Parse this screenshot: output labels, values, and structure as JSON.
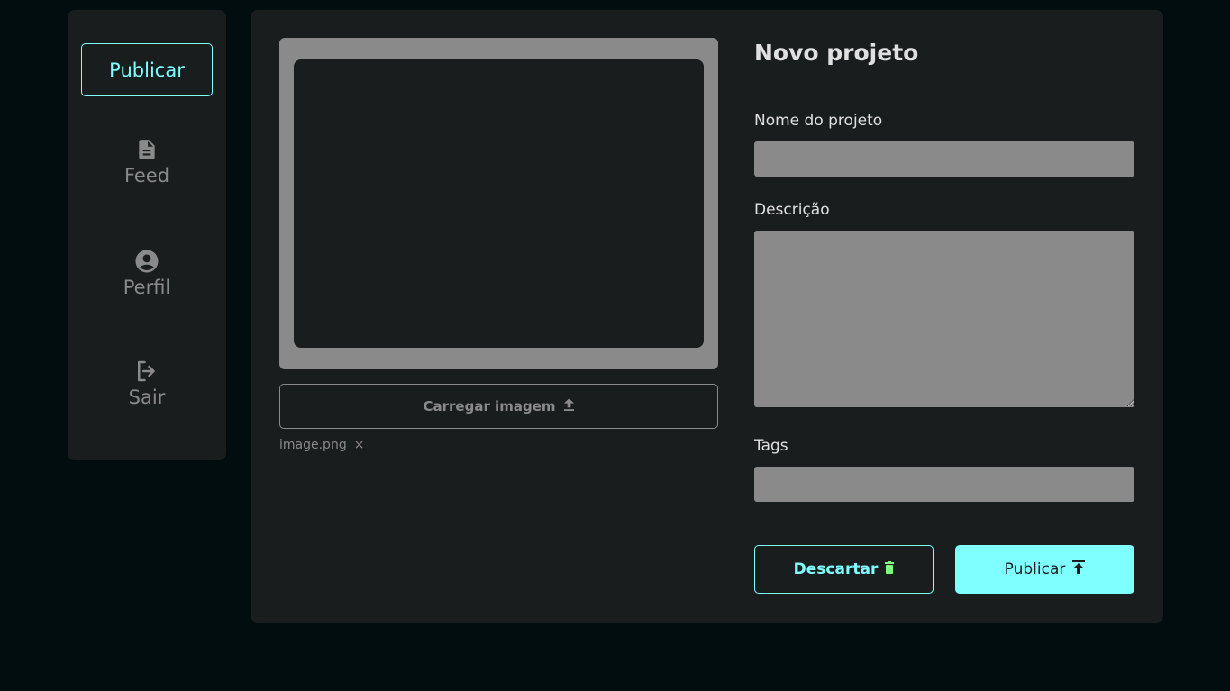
{
  "sidebar": {
    "primary_label": "Publicar",
    "items": [
      {
        "label": "Feed",
        "icon": "document-icon"
      },
      {
        "label": "Perfil",
        "icon": "account-circle-icon"
      },
      {
        "label": "Sair",
        "icon": "logout-icon"
      }
    ]
  },
  "upload": {
    "button_label": "Carregar imagem",
    "file_name": "image.png",
    "remove_glyph": "×"
  },
  "form": {
    "title": "Novo projeto",
    "name_label": "Nome do projeto",
    "name_value": "",
    "description_label": "Descrição",
    "description_value": "",
    "tags_label": "Tags",
    "tags_value": "",
    "discard_label": "Descartar",
    "publish_label": "Publicar"
  },
  "colors": {
    "accent": "#7fffff",
    "panel": "#1a1d1e",
    "background": "#010d0e",
    "muted": "#8a8a8a",
    "discard_icon": "#7dff7d"
  }
}
